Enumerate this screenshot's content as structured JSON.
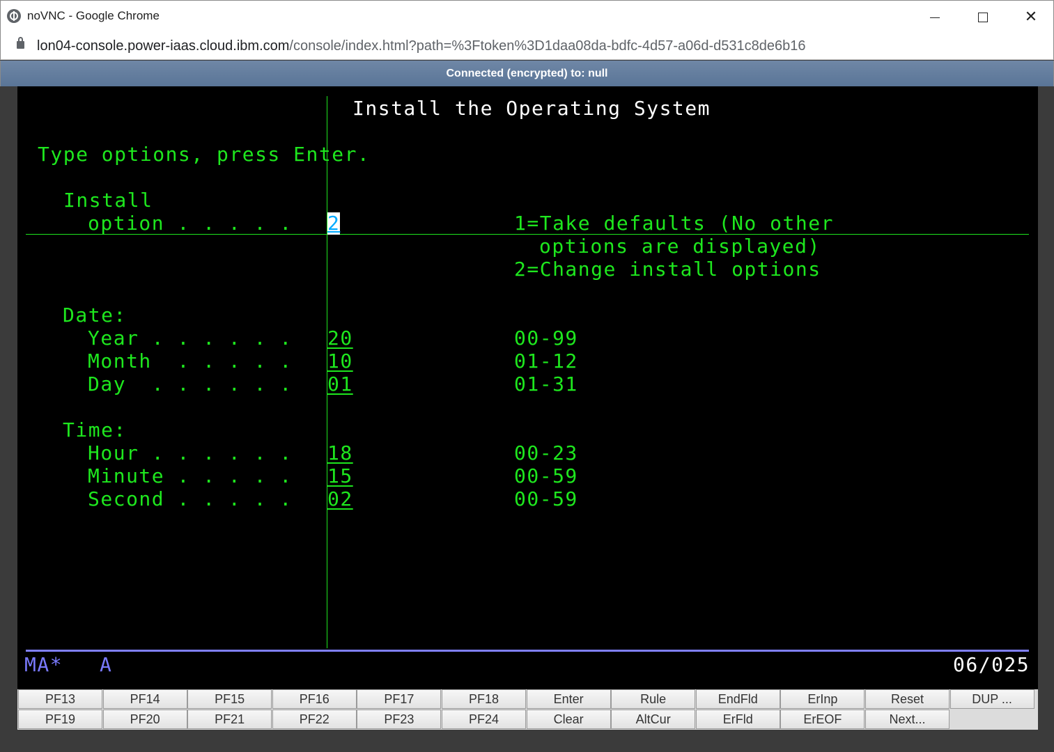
{
  "browser": {
    "window_title": "noVNC - Google Chrome",
    "url_host": "lon04-console.power-iaas.cloud.ibm.com",
    "url_path": "/console/index.html?path=%3Ftoken%3D1daa08da-bdfc-4d57-a06d-d531c8de6b16"
  },
  "novnc": {
    "status": "Connected (encrypted) to: null"
  },
  "terminal": {
    "title": "Install the Operating System",
    "instruction": "Type options, press Enter.",
    "install_label_1": "Install",
    "install_label_2": "option . . . . .",
    "install_value": "2",
    "install_help_1": "1=Take defaults (No other",
    "install_help_2": "options are displayed)",
    "install_help_3": "2=Change install options",
    "date_heading": "Date:",
    "year_label": "Year . . . . . .",
    "year_value": "20",
    "year_range": "00-99",
    "month_label": "Month  . . . . .",
    "month_value": "10",
    "month_range": "01-12",
    "day_label": "Day  . . . . . .",
    "day_value": "01",
    "day_range": "01-31",
    "time_heading": "Time:",
    "hour_label": "Hour . . . . . .",
    "hour_value": "18",
    "hour_range": "00-23",
    "minute_label": "Minute . . . . .",
    "minute_value": "15",
    "minute_range": "00-59",
    "second_label": "Second . . . . .",
    "second_value": "02",
    "second_range": "00-59",
    "status_left": "MA*",
    "status_mode": "A",
    "cursor_position": "06/025"
  },
  "keys": {
    "row1": [
      "PF13",
      "PF14",
      "PF15",
      "PF16",
      "PF17",
      "PF18",
      "Enter",
      "Rule",
      "EndFld",
      "ErInp",
      "Reset",
      "DUP ..."
    ],
    "row2": [
      "PF19",
      "PF20",
      "PF21",
      "PF22",
      "PF23",
      "PF24",
      "Clear",
      "AltCur",
      "ErFld",
      "ErEOF",
      "Next..."
    ]
  }
}
